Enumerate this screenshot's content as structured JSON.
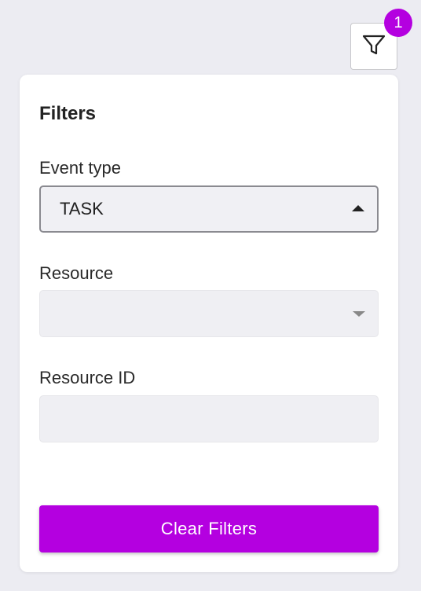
{
  "filter_toggle": {
    "icon": "filter-funnel-icon",
    "badge_count": "1",
    "badge_color": "#B400E0"
  },
  "panel": {
    "title": "Filters",
    "fields": {
      "event_type": {
        "label": "Event type",
        "value": "TASK",
        "state": "expanded"
      },
      "resource": {
        "label": "Resource",
        "value": "",
        "state": "collapsed"
      },
      "resource_id": {
        "label": "Resource ID",
        "value": ""
      }
    },
    "clear_button": {
      "label": "Clear Filters",
      "color": "#B400E0"
    }
  }
}
